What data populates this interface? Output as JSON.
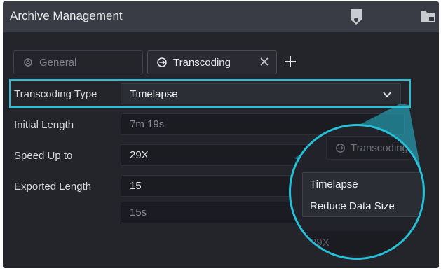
{
  "window": {
    "title": "Archive Management"
  },
  "tabs": {
    "general": {
      "label": "General",
      "icon": "gear-icon"
    },
    "transcoding": {
      "label": "Transcoding",
      "icon": "transcode-icon",
      "close": "✕"
    },
    "add": "+"
  },
  "form": {
    "transcoding_type": {
      "label": "Transcoding Type",
      "value": "Timelapse"
    },
    "initial_length": {
      "label": "Initial Length",
      "value": "7m 19s"
    },
    "speed_up_to": {
      "label": "Speed Up to",
      "value": "29X"
    },
    "exported_length": {
      "label": "Exported Length",
      "value": "15",
      "secondary_value": "15s"
    }
  },
  "magnifier": {
    "partial_button_label": "Transcoding",
    "options": [
      "Timelapse",
      "Reduce Data Size"
    ],
    "bottom_value": "29X"
  },
  "colors": {
    "accent": "#25c1d8",
    "background": "#24252b",
    "titlebar": "#3a3c45"
  }
}
